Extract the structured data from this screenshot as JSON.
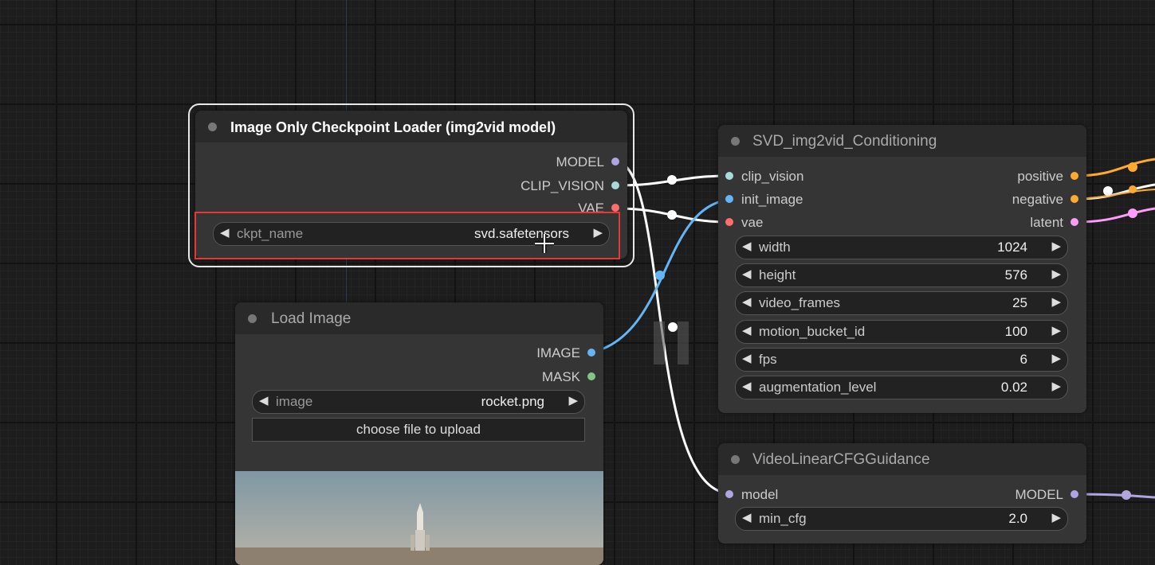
{
  "nodes": {
    "checkpoint_loader": {
      "title": "Image Only Checkpoint Loader (img2vid model)",
      "outputs": [
        "MODEL",
        "CLIP_VISION",
        "VAE"
      ],
      "widget": {
        "label": "ckpt_name",
        "value": "svd.safetensors"
      }
    },
    "load_image": {
      "title": "Load Image",
      "outputs": [
        "IMAGE",
        "MASK"
      ],
      "widget": {
        "label": "image",
        "value": "rocket.png"
      },
      "upload_label": "choose file to upload"
    },
    "svd_conditioning": {
      "title": "SVD_img2vid_Conditioning",
      "inputs": [
        "clip_vision",
        "init_image",
        "vae"
      ],
      "outputs": [
        "positive",
        "negative",
        "latent"
      ],
      "widgets": [
        {
          "label": "width",
          "value": "1024"
        },
        {
          "label": "height",
          "value": "576"
        },
        {
          "label": "video_frames",
          "value": "25"
        },
        {
          "label": "motion_bucket_id",
          "value": "100"
        },
        {
          "label": "fps",
          "value": "6"
        },
        {
          "label": "augmentation_level",
          "value": "0.02"
        }
      ]
    },
    "video_cfg": {
      "title": "VideoLinearCFGGuidance",
      "inputs": [
        "model"
      ],
      "outputs": [
        "MODEL"
      ],
      "widget": {
        "label": "min_cfg",
        "value": "2.0"
      }
    }
  },
  "colors": {
    "model": "#b0a5e0",
    "clip_vision": "#a8dadc",
    "vae": "#ff6e6e",
    "image": "#64b5f6",
    "mask": "#81c784",
    "conditioning": "#ffa931",
    "latent": "#ff9cf9",
    "highlight": "#e53935"
  },
  "icons": [
    "arrow-left-icon",
    "arrow-right-icon",
    "pause-icon",
    "cursor-icon"
  ]
}
